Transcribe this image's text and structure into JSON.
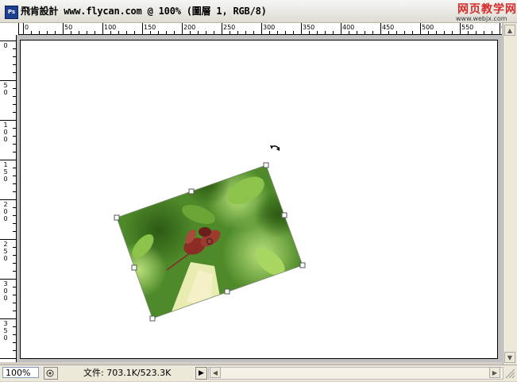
{
  "window": {
    "app_icon_label": "Ps",
    "title": "飛肯設計 www.flycan.com @ 100% (圖層 1, RGB/8)"
  },
  "watermark": {
    "main": "网页教学网",
    "sub": "www.webjx.com"
  },
  "rulers": {
    "horizontal_labels": [
      "0",
      "50",
      "100",
      "150",
      "200",
      "250",
      "300",
      "350",
      "400",
      "450",
      "500",
      "550",
      "6"
    ],
    "vertical_labels": [
      [
        "0"
      ],
      [
        "5",
        "0"
      ],
      [
        "1",
        "0",
        "0"
      ],
      [
        "1",
        "5",
        "0"
      ],
      [
        "2",
        "0",
        "0"
      ],
      [
        "2",
        "5",
        "0"
      ],
      [
        "3",
        "0",
        "0"
      ],
      [
        "3",
        "5",
        "0"
      ]
    ]
  },
  "status": {
    "zoom": "100%",
    "doc_info": "文件: 703.1K/523.3K",
    "play_arrow": "▶"
  },
  "colors": {
    "chrome_bg": "#d4d0c8",
    "canvas_bg": "#ffffff",
    "title_text": "#000000",
    "watermark_red": "#d62a2a"
  },
  "icons": [
    "photoshop-app-icon",
    "rotate-cursor-icon",
    "status-menu-icon",
    "play-arrow-icon",
    "scroll-left-arrow-icon",
    "scroll-right-arrow-icon",
    "scroll-up-arrow-icon",
    "scroll-down-arrow-icon",
    "resize-grip-icon"
  ]
}
